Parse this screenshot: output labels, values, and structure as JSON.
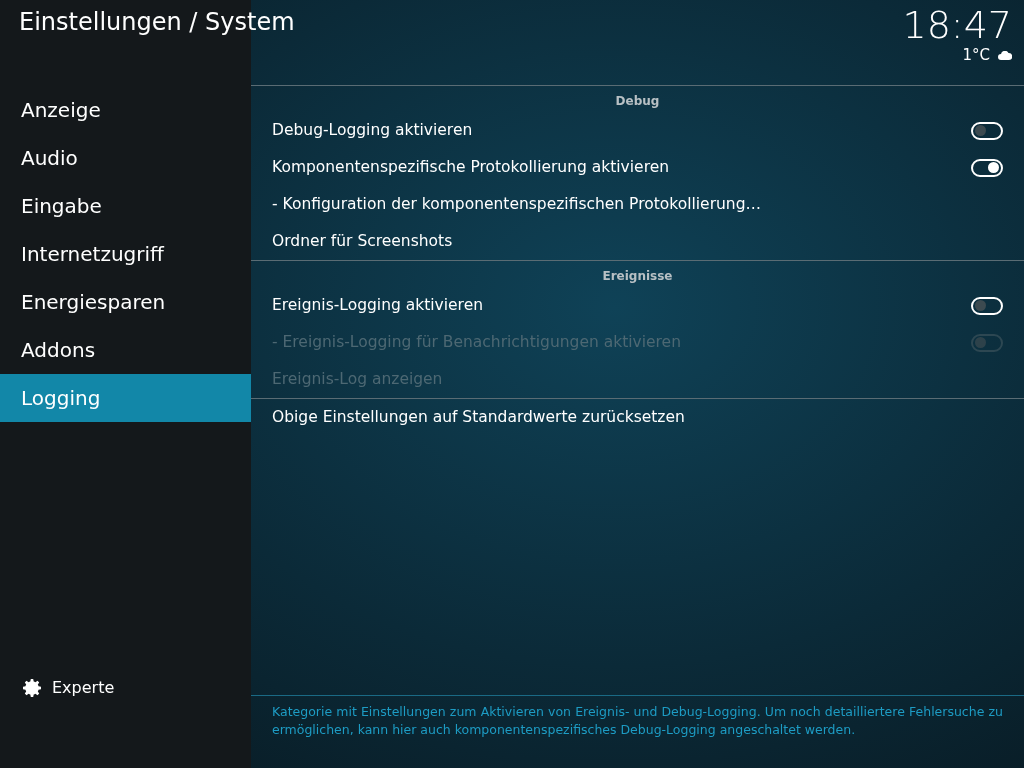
{
  "header": {
    "title": "Einstellungen / System",
    "time": "18:47",
    "temperature": "1°C"
  },
  "sidebar": {
    "items": [
      {
        "label": "Anzeige",
        "selected": false
      },
      {
        "label": "Audio",
        "selected": false
      },
      {
        "label": "Eingabe",
        "selected": false
      },
      {
        "label": "Internetzugriff",
        "selected": false
      },
      {
        "label": "Energiesparen",
        "selected": false
      },
      {
        "label": "Addons",
        "selected": false
      },
      {
        "label": "Logging",
        "selected": true
      }
    ],
    "level_button": "Experte"
  },
  "sections": [
    {
      "title": "Debug",
      "settings": [
        {
          "kind": "toggle",
          "label": "Debug-Logging aktivieren",
          "on": false,
          "disabled": false
        },
        {
          "kind": "toggle",
          "label": "Komponentenspezifische Protokollierung aktivieren",
          "on": true,
          "disabled": false
        },
        {
          "kind": "action",
          "label": "- Konfiguration der komponentenspezifischen Protokollierung…",
          "disabled": false
        },
        {
          "kind": "action",
          "label": "Ordner für Screenshots",
          "disabled": false
        }
      ]
    },
    {
      "title": "Ereignisse",
      "settings": [
        {
          "kind": "toggle",
          "label": "Ereignis-Logging aktivieren",
          "on": false,
          "disabled": false
        },
        {
          "kind": "toggle",
          "label": "- Ereignis-Logging für Benachrichtigungen aktivieren",
          "on": false,
          "disabled": true
        },
        {
          "kind": "action",
          "label": "Ereignis-Log anzeigen",
          "disabled": true
        }
      ]
    },
    {
      "settings": [
        {
          "kind": "action",
          "label": "Obige Einstellungen auf Standardwerte zurücksetzen",
          "disabled": false
        }
      ]
    }
  ],
  "description": "Kategorie mit Einstellungen zum Aktivieren von Ereignis- und Debug-Logging. Um noch detailliertere Fehlersuche zu ermöglichen, kann hier auch komponentenspezifisches Debug-Logging angeschaltet werden."
}
